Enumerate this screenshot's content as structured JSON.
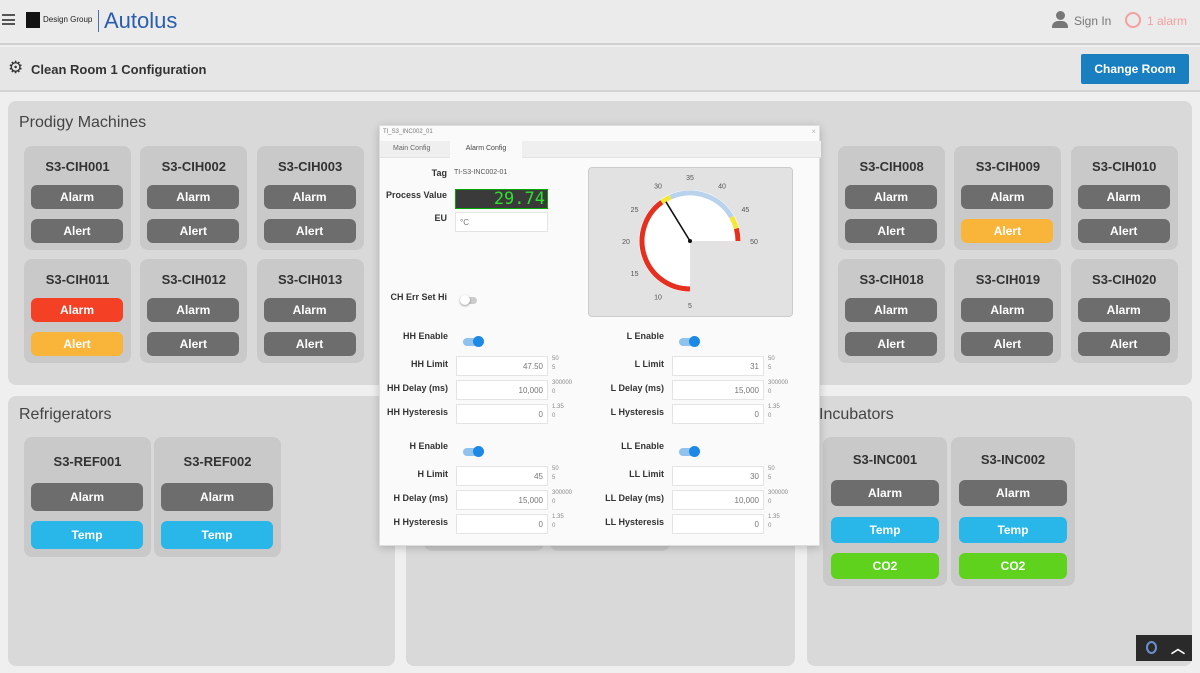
{
  "header": {
    "brand_small": "Design Group",
    "brand": "Autolus",
    "sign_in": "Sign In",
    "alarm_count": "1 alarm",
    "icons": [
      "menu-icon",
      "user-icon",
      "alarm-clock-icon"
    ]
  },
  "subheader": {
    "title": "Clean Room 1 Configuration",
    "change_room": "Change Room"
  },
  "colors": {
    "accent": "#1a7fc1",
    "grey_button": "#6d6d6d",
    "alarm_red": "#f44025",
    "alert_orange": "#f9b43a",
    "temp_blue": "#29b6e8",
    "co2_green": "#5fd21e"
  },
  "prodigy": {
    "title": "Prodigy Machines",
    "cards": [
      {
        "name": "S3-CIH001",
        "slot": 0,
        "row": 0,
        "alarm": "normal",
        "alert": "normal"
      },
      {
        "name": "S3-CIH002",
        "slot": 1,
        "row": 0,
        "alarm": "normal",
        "alert": "normal"
      },
      {
        "name": "S3-CIH003",
        "slot": 2,
        "row": 0,
        "alarm": "normal",
        "alert": "normal"
      },
      {
        "name": "S3-CIH008",
        "slot": 7,
        "row": 0,
        "alarm": "normal",
        "alert": "normal"
      },
      {
        "name": "S3-CIH009",
        "slot": 8,
        "row": 0,
        "alarm": "normal",
        "alert": "active"
      },
      {
        "name": "S3-CIH010",
        "slot": 9,
        "row": 0,
        "alarm": "normal",
        "alert": "normal"
      },
      {
        "name": "S3-CIH011",
        "slot": 0,
        "row": 1,
        "alarm": "active",
        "alert": "active"
      },
      {
        "name": "S3-CIH012",
        "slot": 1,
        "row": 1,
        "alarm": "normal",
        "alert": "normal"
      },
      {
        "name": "S3-CIH013",
        "slot": 2,
        "row": 1,
        "alarm": "normal",
        "alert": "normal"
      },
      {
        "name": "S3-CIH018",
        "slot": 7,
        "row": 1,
        "alarm": "normal",
        "alert": "normal"
      },
      {
        "name": "S3-CIH019",
        "slot": 8,
        "row": 1,
        "alarm": "normal",
        "alert": "normal"
      },
      {
        "name": "S3-CIH020",
        "slot": 9,
        "row": 1,
        "alarm": "normal",
        "alert": "normal"
      }
    ],
    "alarm_label": "Alarm",
    "alert_label": "Alert"
  },
  "refrigerators": {
    "title": "Refrigerators",
    "cards": [
      "S3-REF001",
      "S3-REF002"
    ],
    "alarm_label": "Alarm",
    "temp_label": "Temp"
  },
  "incubators": {
    "title": "Incubators",
    "cards": [
      "S3-INC001",
      "S3-INC002"
    ],
    "alarm_label": "Alarm",
    "temp_label": "Temp",
    "co2_label": "CO2"
  },
  "dialog": {
    "title": "TI_S3_INC002_01",
    "tabs": [
      "Main Config",
      "Alarm Config"
    ],
    "active_tab": 1,
    "tag_label": "Tag",
    "tag": "TI-S3-INC002-01",
    "pv_label": "Process Value",
    "pv": "29.74",
    "eu_label": "EU",
    "eu": "°C",
    "ch_err_label": "CH Err Set Hi",
    "ch_err": false,
    "gauge": {
      "min": 5,
      "max": 50,
      "value": 29.74,
      "ticks": [
        5,
        10,
        15,
        20,
        25,
        30,
        35,
        40,
        45,
        50
      ],
      "bands": [
        {
          "from": 5,
          "to": 29,
          "color": "#e53020"
        },
        {
          "from": 29,
          "to": 31,
          "color": "#f5e63a"
        },
        {
          "from": 31,
          "to": 45,
          "color": "#b9d3ec"
        },
        {
          "from": 45,
          "to": 47.5,
          "color": "#f5e63a"
        },
        {
          "from": 47.5,
          "to": 50,
          "color": "#e53020"
        }
      ]
    },
    "left": [
      {
        "enable_label": "HH Enable",
        "enabled": true,
        "fields": [
          {
            "label": "HH Limit",
            "value": "47.50",
            "max": "50",
            "min": "5"
          },
          {
            "label": "HH Delay (ms)",
            "value": "10,000",
            "max": "300000",
            "min": "0"
          },
          {
            "label": "HH Hysteresis",
            "value": "0",
            "max": "1.35",
            "min": "0"
          }
        ]
      },
      {
        "enable_label": "H Enable",
        "enabled": true,
        "fields": [
          {
            "label": "H Limit",
            "value": "45",
            "max": "50",
            "min": "5"
          },
          {
            "label": "H Delay (ms)",
            "value": "15,000",
            "max": "300000",
            "min": "0"
          },
          {
            "label": "H Hysteresis",
            "value": "0",
            "max": "1.35",
            "min": "0"
          }
        ]
      }
    ],
    "right": [
      {
        "enable_label": "L Enable",
        "enabled": true,
        "fields": [
          {
            "label": "L Limit",
            "value": "31",
            "max": "50",
            "min": "5"
          },
          {
            "label": "L Delay (ms)",
            "value": "15,000",
            "max": "300000",
            "min": "0"
          },
          {
            "label": "L Hysteresis",
            "value": "0",
            "max": "1.35",
            "min": "0"
          }
        ]
      },
      {
        "enable_label": "LL Enable",
        "enabled": true,
        "fields": [
          {
            "label": "LL Limit",
            "value": "30",
            "max": "50",
            "min": "5"
          },
          {
            "label": "LL Delay (ms)",
            "value": "10,000",
            "max": "300000",
            "min": "0"
          },
          {
            "label": "LL Hysteresis",
            "value": "0",
            "max": "1.35",
            "min": "0"
          }
        ]
      }
    ]
  }
}
